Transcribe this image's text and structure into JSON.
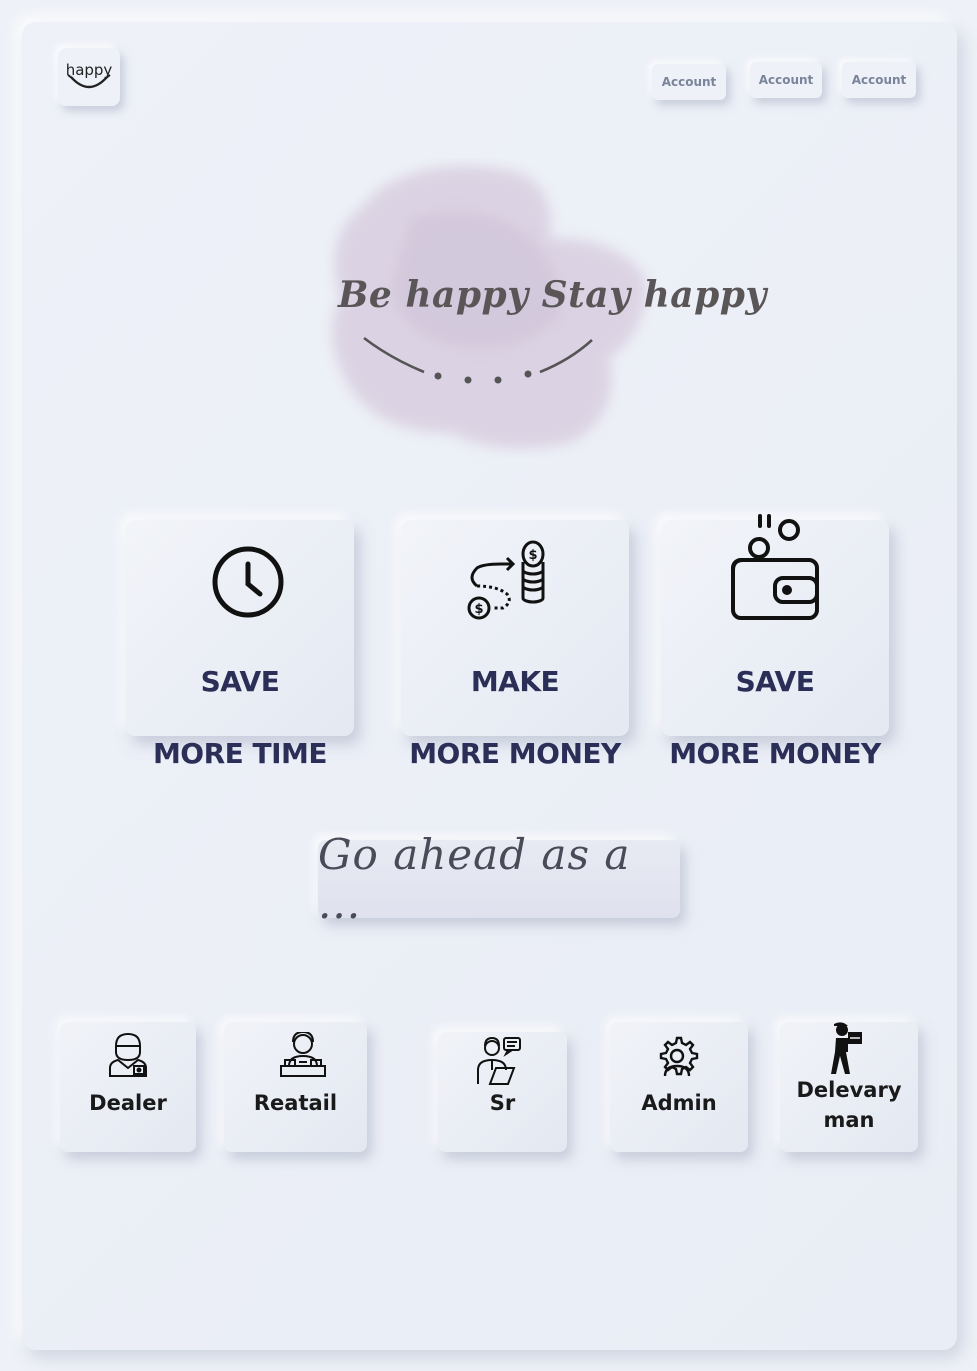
{
  "brand": {
    "logo_text": "happy"
  },
  "header": {
    "account_buttons": [
      "Account",
      "Account",
      "Account"
    ]
  },
  "hero": {
    "tagline": "Be happy Stay happy"
  },
  "features": [
    {
      "line1": "SAVE",
      "line2": "MORE TIME",
      "icon": "clock-icon"
    },
    {
      "line1": "MAKE",
      "line2": "MORE MONEY",
      "icon": "coins-path-icon"
    },
    {
      "line1": "SAVE",
      "line2": "MORE MONEY",
      "icon": "wallet-icon"
    }
  ],
  "prompt": {
    "text": "Go ahead as a ..."
  },
  "roles": [
    {
      "label": "Dealer",
      "icon": "dealer-icon"
    },
    {
      "label": "Reatail",
      "icon": "retailer-icon"
    },
    {
      "label": "Sr",
      "icon": "sales-rep-icon"
    },
    {
      "label": "Admin",
      "icon": "admin-gear-icon"
    },
    {
      "label": "Delevary man",
      "line1": "Delevary",
      "line2": "man",
      "icon": "delivery-man-icon"
    }
  ],
  "colors": {
    "background": "#eef1f7",
    "feature_text": "#2b2f58",
    "hero_blob": "#d9cfe0",
    "account_text": "#7a849a"
  }
}
